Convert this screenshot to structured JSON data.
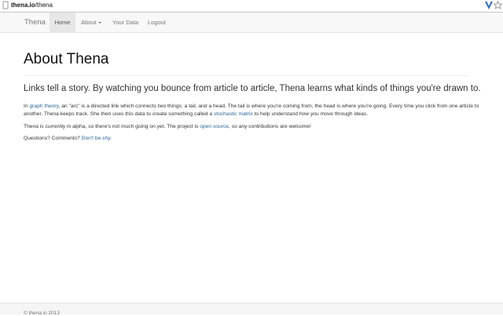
{
  "browser": {
    "url_domain": "thena.io",
    "url_path": "/thena"
  },
  "navbar": {
    "brand": "Thena",
    "items": [
      {
        "label": "Home",
        "active": true
      },
      {
        "label": "About",
        "dropdown": true
      },
      {
        "label": "Your Data"
      },
      {
        "label": "Logout"
      }
    ]
  },
  "main": {
    "title": "About Thena",
    "lead": "Links tell a story. By watching you bounce from article to article, Thena learns what kinds of things you're drawn to.",
    "p1": {
      "t1": "In ",
      "link1": "graph theory",
      "t2": ", an \"arc\" is a directed link which connects two things: a tail, and a head. The tail is where you're coming from, the head is where you're going. Every time you click from one article to another, Thena keeps track. She then uses this data to create something called a ",
      "link2": "stochastic matrix",
      "t3": " to help understand how you move through ideas."
    },
    "p2": {
      "t1": "Thena is currently in alpha, so there's not much going on yet. The project is ",
      "link": "open source",
      "t2": ", so any contributions are welcome!"
    },
    "p3": {
      "t1": "Questions? Comments? ",
      "link": "Don't be shy",
      "t2": "."
    }
  },
  "footer": {
    "text": "© thena.io 2013"
  },
  "colors": {
    "link": "#2a6496",
    "navbar_bg": "#f8f8f8",
    "active_bg": "#e7e7e7"
  },
  "icons": {
    "address_prefix": "page-icon",
    "extension": "v-extension-icon",
    "bookmark": "star-icon"
  }
}
